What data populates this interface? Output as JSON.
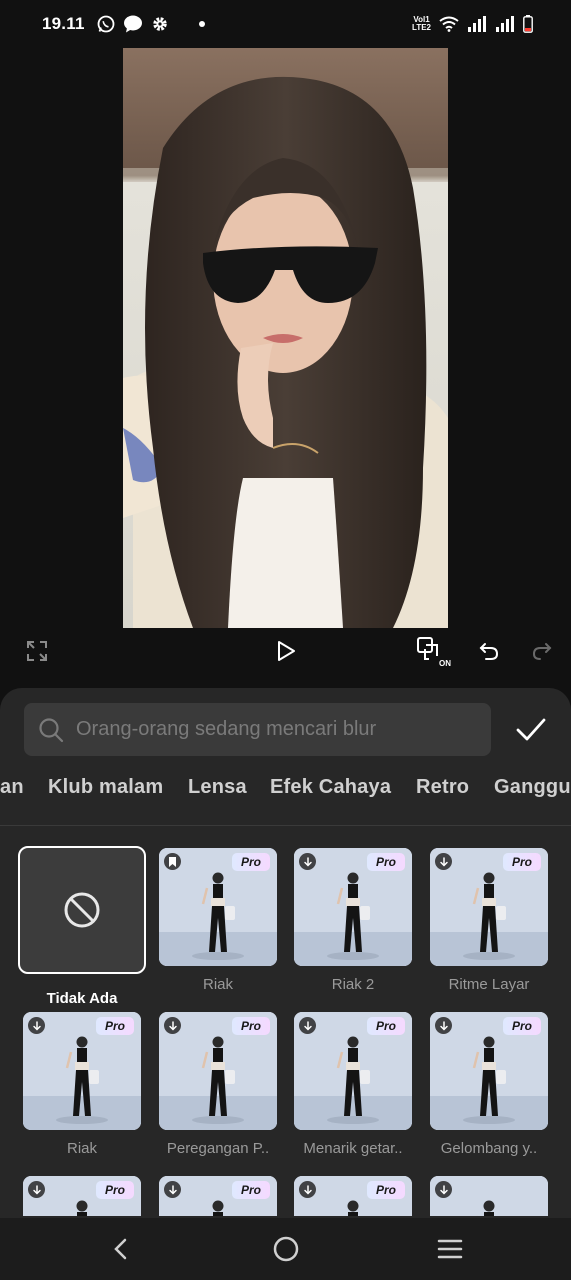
{
  "status_bar": {
    "time": "19.11",
    "network_label_top": "Vol1",
    "network_label_bottom": "LTE2"
  },
  "search": {
    "placeholder": "Orang-orang sedang mencari blur"
  },
  "tabs": [
    "an",
    "Klub malam",
    "Lensa",
    "Efek Cahaya",
    "Retro",
    "Ganggu"
  ],
  "effects": [
    {
      "label": "Tidak Ada",
      "selected": true,
      "pro": false
    },
    {
      "label": "Riak",
      "pro": true,
      "badge": "bookmark-icon"
    },
    {
      "label": "Riak 2",
      "pro": true,
      "badge": "download-icon"
    },
    {
      "label": "Ritme Layar",
      "pro": true,
      "badge": "download-icon"
    },
    {
      "label": "Riak",
      "pro": true,
      "badge": "download-icon"
    },
    {
      "label": "Peregangan P..",
      "pro": true,
      "badge": "download-icon"
    },
    {
      "label": "Menarik getar..",
      "pro": true,
      "badge": "download-icon"
    },
    {
      "label": "Gelombang y..",
      "pro": true,
      "badge": "download-icon"
    },
    {
      "label": "",
      "pro": true,
      "badge": "download-icon"
    },
    {
      "label": "",
      "pro": true,
      "badge": "download-icon"
    },
    {
      "label": "",
      "pro": true,
      "badge": "download-icon"
    },
    {
      "label": "",
      "pro": false,
      "badge": "download-icon"
    }
  ],
  "pro_label": "Pro",
  "compare_label": "ON",
  "colors": {
    "background": "#111111",
    "panel": "#272727",
    "search_box": "#3a3a3a",
    "pro_badge_start": "#dfe9ff",
    "pro_badge_end": "#f5d9ff"
  }
}
